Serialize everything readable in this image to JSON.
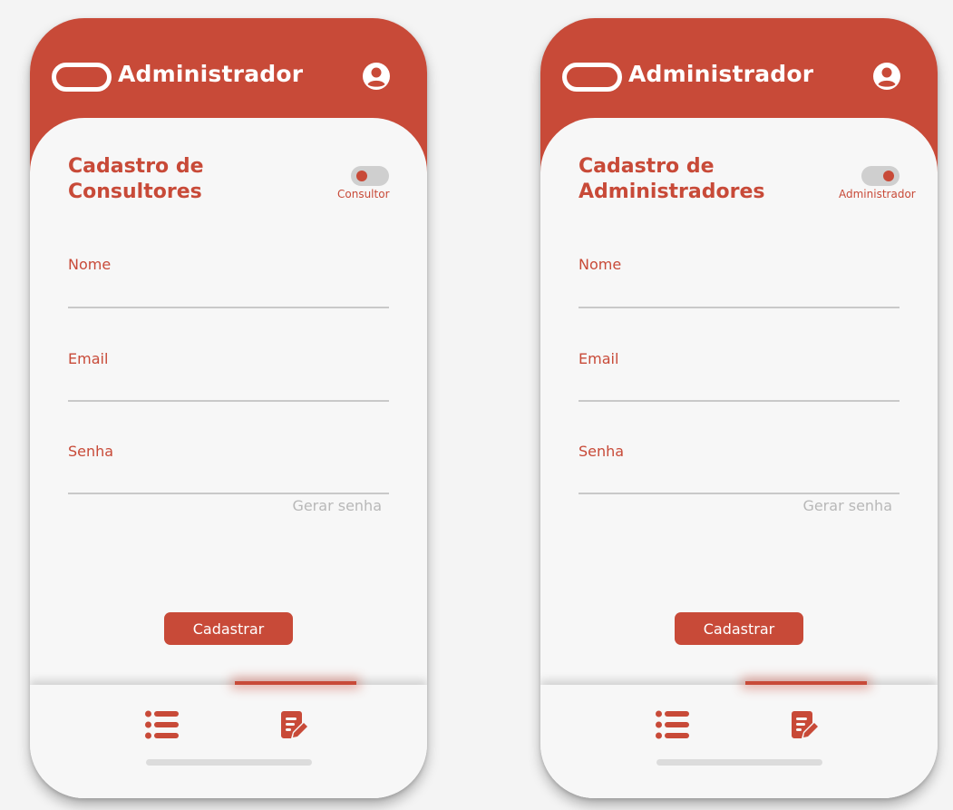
{
  "colors": {
    "primary": "#c84a38",
    "background": "#f7f7f7",
    "muted": "#b8b8b8"
  },
  "screens": [
    {
      "header": {
        "title": "Administrador",
        "logo_icon": "pill-logo-icon",
        "profile_icon": "user-circle-icon"
      },
      "form": {
        "title_line1": "Cadastro de",
        "title_line2": "Consultores",
        "toggle_label": "Consultor",
        "toggle_state": "off",
        "fields": [
          {
            "label": "Nome",
            "value": ""
          },
          {
            "label": "Email",
            "value": ""
          },
          {
            "label": "Senha",
            "value": ""
          }
        ],
        "generate_password": "Gerar senha",
        "submit_label": "Cadastrar"
      },
      "nav": {
        "items": [
          "list-icon",
          "edit-document-icon"
        ],
        "active": 1
      }
    },
    {
      "header": {
        "title": "Administrador",
        "logo_icon": "pill-logo-icon",
        "profile_icon": "user-circle-icon"
      },
      "form": {
        "title_line1": "Cadastro de",
        "title_line2": "Administradores",
        "toggle_label": "Administrador",
        "toggle_state": "on",
        "fields": [
          {
            "label": "Nome",
            "value": ""
          },
          {
            "label": "Email",
            "value": ""
          },
          {
            "label": "Senha",
            "value": ""
          }
        ],
        "generate_password": "Gerar senha",
        "submit_label": "Cadastrar"
      },
      "nav": {
        "items": [
          "list-icon",
          "edit-document-icon"
        ],
        "active": 1
      }
    }
  ]
}
